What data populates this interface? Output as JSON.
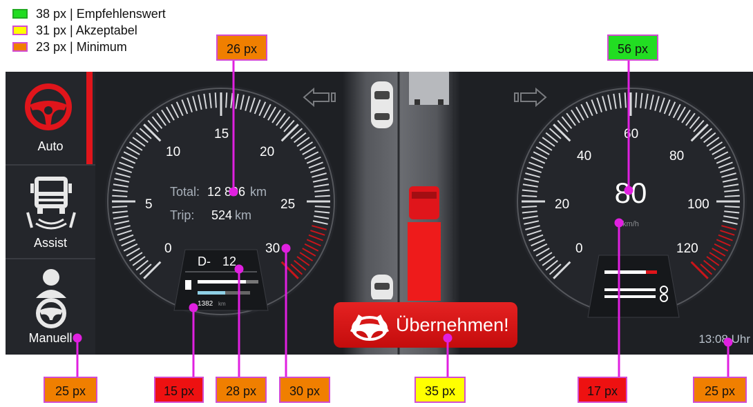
{
  "legend": [
    {
      "label": "38 px | Empfehlenswert",
      "color": "#22dd22"
    },
    {
      "label": "31 px | Akzeptabel",
      "color": "#ffff00"
    },
    {
      "label": "23 px | Minimum",
      "color": "#f07f00"
    }
  ],
  "sidebar": {
    "items": [
      {
        "label": "Auto",
        "icon": "steering-wheel-icon",
        "active": true
      },
      {
        "label": "Assist",
        "icon": "truck-assist-icon",
        "active": false
      },
      {
        "label": "Manuell",
        "icon": "driver-manual-icon",
        "active": false
      }
    ]
  },
  "tacho": {
    "ticks": [
      "0",
      "5",
      "10",
      "15",
      "20",
      "25",
      "30"
    ],
    "total_label": "Total:",
    "total_value": "12 896",
    "total_unit": "km",
    "trip_label": "Trip:",
    "trip_value": "524",
    "trip_unit": "km",
    "gear": "D-",
    "gear_value": "12",
    "range_value": "1382",
    "range_unit": "km"
  },
  "speedo": {
    "ticks": [
      "0",
      "20",
      "40",
      "60",
      "80",
      "100",
      "120"
    ],
    "speed": "80",
    "unit": "km/h"
  },
  "takeover_label": "Übernehmen!",
  "clock": "13:08 Uhr",
  "annotations": {
    "tacho_total": "26 px",
    "speed": "56 px",
    "manuell": "25 px",
    "range": "15 px",
    "gear": "28 px",
    "tick30": "30 px",
    "takeover": "35 px",
    "speed_unit": "17 px",
    "clock": "25 px"
  },
  "colors": {
    "accent": "#e0151b",
    "annotation_border": "#d24bd2",
    "background": "#1e2024"
  }
}
